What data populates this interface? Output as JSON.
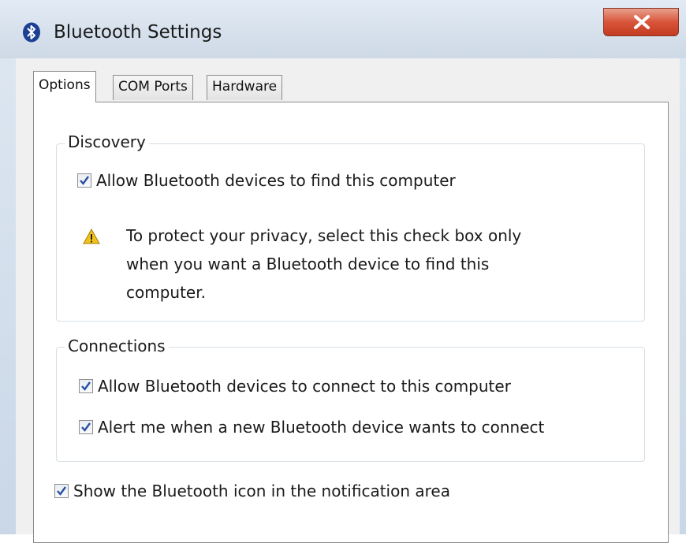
{
  "window": {
    "title": "Bluetooth Settings",
    "close_glyph": "X"
  },
  "tabs": [
    {
      "label": "Options",
      "active": true
    },
    {
      "label": "COM Ports",
      "active": false
    },
    {
      "label": "Hardware",
      "active": false
    }
  ],
  "discovery": {
    "legend": "Discovery",
    "allow_find": {
      "label": "Allow Bluetooth devices to find this computer",
      "checked": true
    },
    "warning": {
      "icon": "warning-icon",
      "lines": [
        "To protect your privacy, select this check box only",
        "when you want a Bluetooth device to find this",
        "computer."
      ]
    }
  },
  "connections": {
    "legend": "Connections",
    "allow_connect": {
      "label": "Allow Bluetooth devices to connect to this computer",
      "checked": true
    },
    "alert_new": {
      "label": "Alert me when a new Bluetooth device wants to connect",
      "checked": true
    }
  },
  "show_icon": {
    "label": "Show the Bluetooth icon in the notification area",
    "checked": true
  },
  "colors": {
    "close_button": "#c23b22",
    "checkmark": "#2b4fa0",
    "warning_yellow": "#f2c21b"
  }
}
